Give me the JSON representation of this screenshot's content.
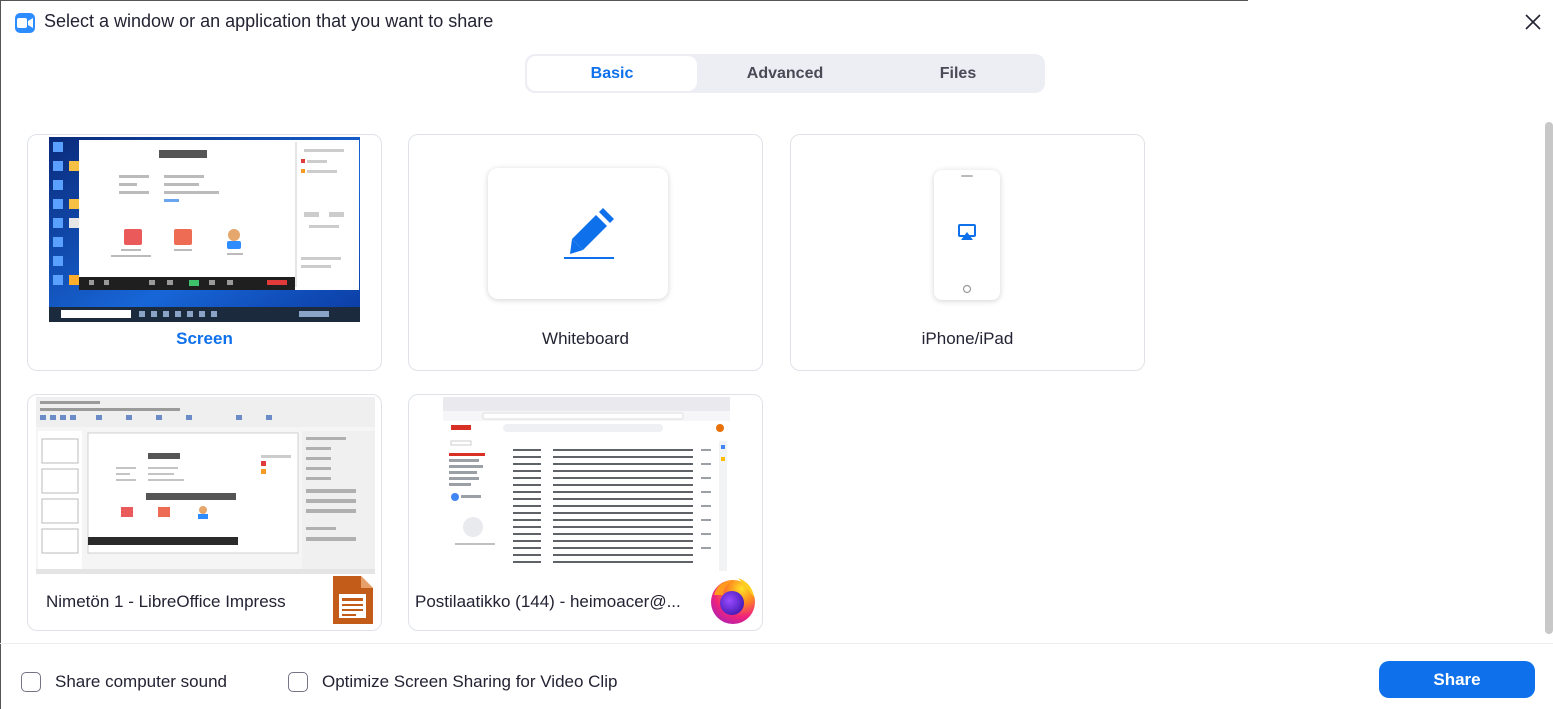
{
  "window": {
    "title": "Select a window or an application that you want to share",
    "brand_color": "#2d8cff"
  },
  "tabs": [
    {
      "label": "Basic",
      "active": true
    },
    {
      "label": "Advanced",
      "active": false
    },
    {
      "label": "Files",
      "active": false
    }
  ],
  "sources": [
    {
      "label": "Screen",
      "selected": true,
      "icon": "desktop-screenshot"
    },
    {
      "label": "Whiteboard",
      "selected": false,
      "icon": "pen-icon"
    },
    {
      "label": "iPhone/iPad",
      "selected": false,
      "icon": "airplay-icon"
    },
    {
      "label": "Nimetön 1 - LibreOffice Impress",
      "selected": false,
      "icon": "libreoffice-impress-icon"
    },
    {
      "label": "Postilaatikko (144) - heimoacer@...",
      "selected": false,
      "icon": "firefox-icon"
    }
  ],
  "footer": {
    "share_sound_label": "Share computer sound",
    "share_sound_checked": false,
    "optimize_video_label": "Optimize Screen Sharing for Video Clip",
    "optimize_video_checked": false,
    "share_button_label": "Share"
  },
  "colors": {
    "accent": "#0e71eb",
    "tab_bg": "#ededf4",
    "card_border": "#dfe3e8"
  }
}
